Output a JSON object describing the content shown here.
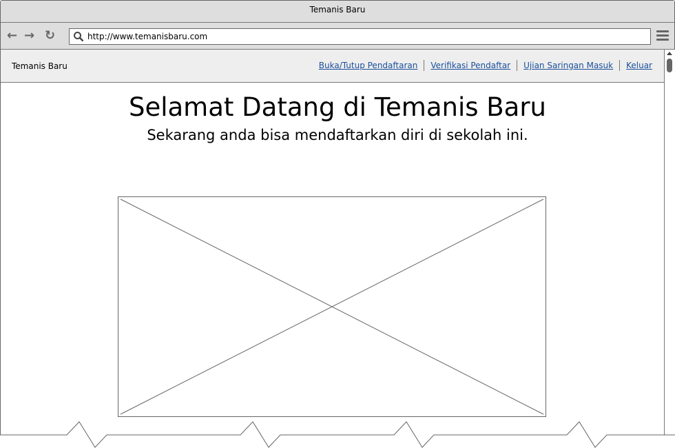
{
  "window": {
    "title": "Temanis Baru"
  },
  "browser": {
    "url": "http://www.temanisbaru.com",
    "icons": [
      "back-arrow-icon",
      "forward-arrow-icon",
      "reload-icon",
      "search-icon",
      "hamburger-menu-icon"
    ]
  },
  "navbar": {
    "brand": "Temanis Baru",
    "links": [
      "Buka/Tutup Pendaftaran",
      "Verifikasi Pendaftar",
      "Ujian Saringan Masuk",
      "Keluar"
    ],
    "link_color": "#1a4f9c"
  },
  "main": {
    "title": "Selamat Datang di Temanis Baru",
    "subtitle": "Sekarang anda bisa mendaftarkan diri di sekolah ini."
  }
}
